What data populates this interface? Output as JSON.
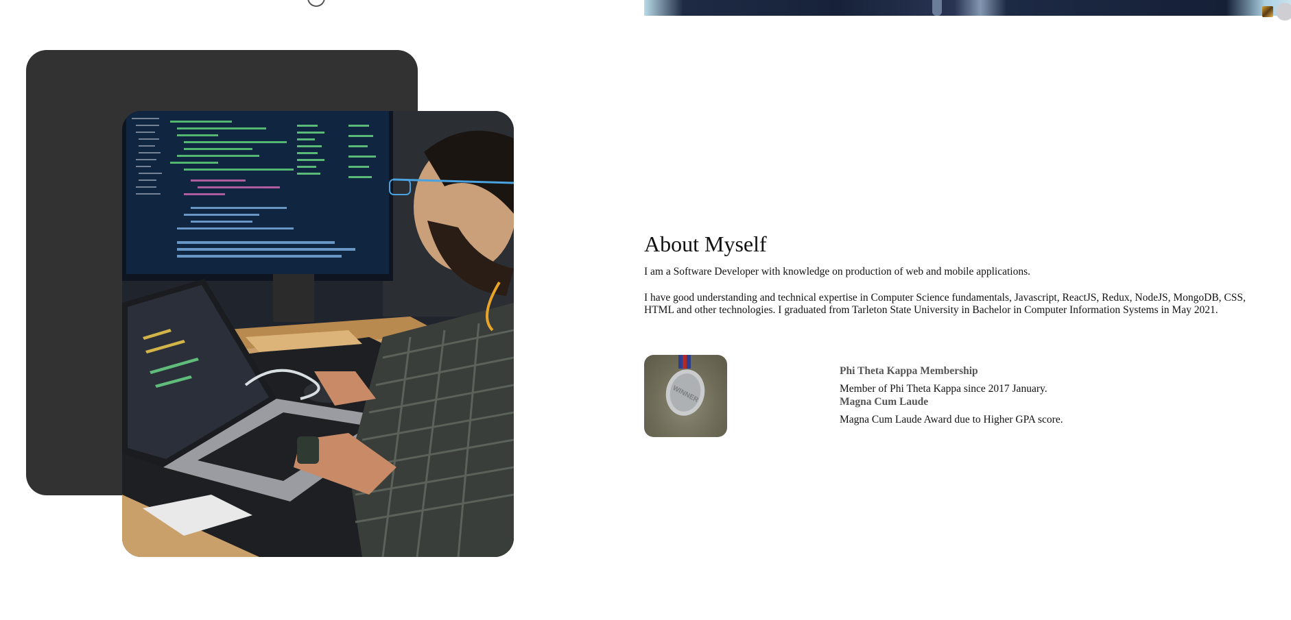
{
  "about": {
    "heading": "About Myself",
    "paragraph1": "I am a Software Developer with knowledge on production of web and mobile applications.",
    "paragraph2": "I have good understanding and technical expertise in Computer Science fundamentals, Javascript, ReactJS, Redux, NodeJS, MongoDB, CSS, HTML and other technologies. I graduated from Tarleton State University in Bachelor in Computer Information Systems in May 2021."
  },
  "awards": {
    "items": [
      {
        "title": "Phi Theta Kappa Membership",
        "description": "Member of Phi Theta Kappa since 2017 January."
      },
      {
        "title": "Magna Cum Laude",
        "description": "Magna Cum Laude Award due to Higher GPA score."
      }
    ],
    "thumbnail_text": "WINNER"
  },
  "colors": {
    "dark_card": "#323232",
    "award_title": "#555555",
    "text": "#111111"
  },
  "icons": {
    "photo": "developer-at-desk-photo",
    "medal": "medal-icon"
  }
}
